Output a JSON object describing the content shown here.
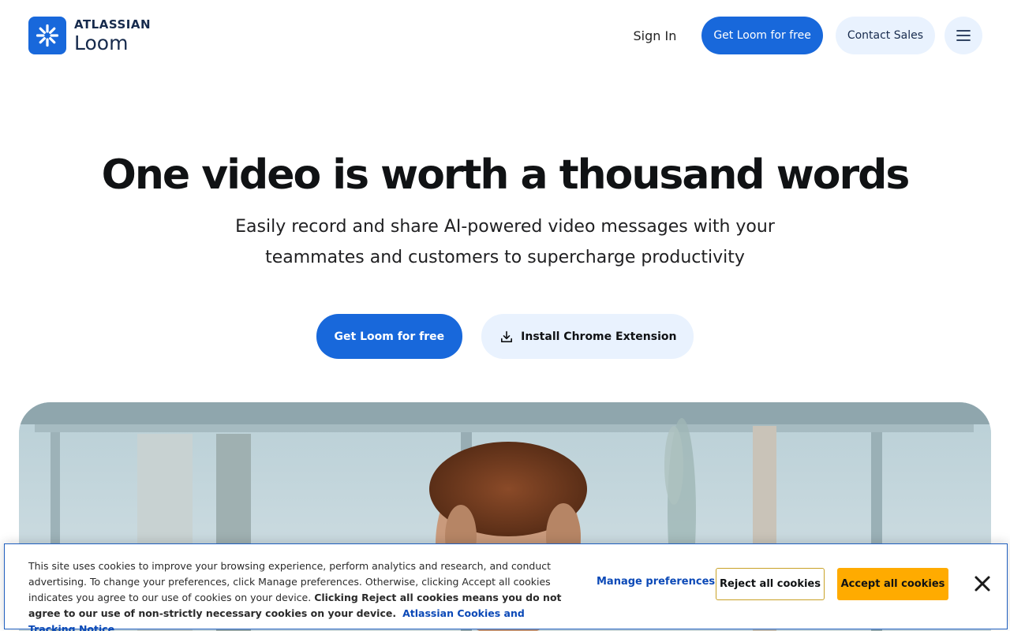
{
  "header": {
    "logo": {
      "company": "ATLASSIAN",
      "product": "Loom",
      "icon": "loom-burst-icon",
      "color": "#1868db"
    },
    "nav": {
      "signin_label": "Sign In",
      "get_loom_label": "Get Loom for free",
      "contact_sales_label": "Contact Sales",
      "menu_icon": "hamburger-menu-icon"
    }
  },
  "hero": {
    "title": "One video is worth a thousand words",
    "subtitle_line1": "Easily record and share AI-powered video messages with your",
    "subtitle_line2": "teammates and customers to supercharge productivity",
    "cta_primary_label": "Get Loom for free",
    "cta_secondary_label": "Install Chrome Extension",
    "cta_secondary_icon": "download-icon"
  },
  "cookie_banner": {
    "text_plain": "This site uses cookies to improve your browsing experience, perform analytics and research, and conduct advertising. To change your preferences, click Manage preferences. Otherwise, clicking Accept all cookies indicates you agree to our use of cookies on your device.",
    "text_bold": "Clicking Reject all cookies means you do not agree to our use of non-strictly necessary cookies on your device.",
    "link_label": "Atlassian Cookies and Tracking Notice",
    "manage_label": "Manage preferences",
    "reject_label": "Reject all cookies",
    "accept_label": "Accept all cookies",
    "close_icon": "close-icon"
  },
  "colors": {
    "brand_blue": "#1868db",
    "light_blue": "#e9f2fe",
    "accept_yellow": "#ffab00"
  }
}
